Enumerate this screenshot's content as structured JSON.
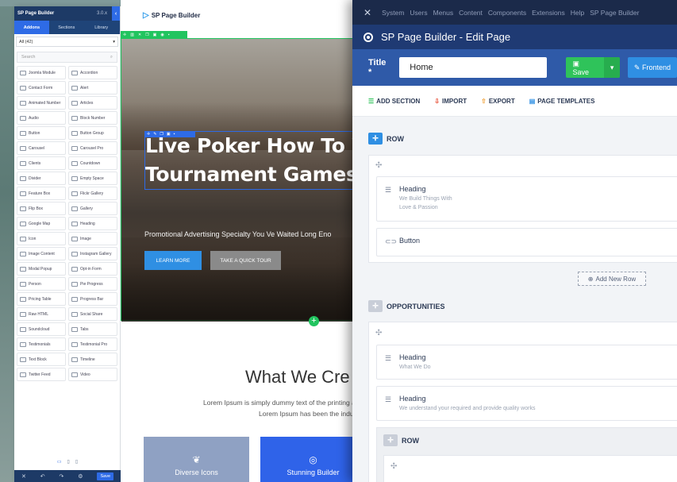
{
  "panel": {
    "title": "SP Page Builder",
    "version": "3.0.x",
    "collapse_icon": "‹",
    "tabs": [
      "Addons",
      "Sections",
      "Library"
    ],
    "filter": "All (42)",
    "search_placeholder": "Search",
    "addons": [
      "Joomla Module",
      "Accordion",
      "Contact Form",
      "Alert",
      "Animated Number",
      "Articles",
      "Audio",
      "Block Number",
      "Button",
      "Button Group",
      "Carousel",
      "Carousel Pro",
      "Clients",
      "Countdown",
      "Divider",
      "Empty Space",
      "Feature Box",
      "Flickr Gallery",
      "Flip Box",
      "Gallery",
      "Google Map",
      "Heading",
      "Icon",
      "Image",
      "Image Content",
      "Instagram Gallery",
      "Modal Popup",
      "Opt-in Form",
      "Person",
      "Pie Progress",
      "Pricing Table",
      "Progress Bar",
      "Raw HTML",
      "Social Share",
      "Soundcloud",
      "Tabs",
      "Testimonials",
      "Testimonial Pro",
      "Text Block",
      "Timeline",
      "Twitter Feed",
      "Video"
    ],
    "devices": [
      "▭",
      "▯",
      "▯"
    ],
    "footer": {
      "close": "✕",
      "undo": "↶",
      "redo": "↷",
      "settings": "⚙",
      "save": "Save"
    }
  },
  "canvas": {
    "logo": "SP Page Builder",
    "hero_line1": "Live Poker How To W",
    "hero_line2": "Tournament Games",
    "hero_sub": "Promotional Advertising Specialty You Ve Waited Long Eno",
    "learn_more": "LEARN MORE",
    "tour": "TAKE A QUICK TOUR",
    "add_symbol": "+",
    "section_title": "What We Cre",
    "section_text1": "Lorem Ipsum is simply dummy text of the printing a",
    "section_text2": "Lorem Ipsum has been the indu",
    "card1": "Diverse Icons",
    "card2": "Stunning Builder"
  },
  "admin": {
    "menu": [
      "System",
      "Users",
      "Menus",
      "Content",
      "Components",
      "Extensions",
      "Help",
      "SP Page Builder"
    ],
    "window_title": "SP Page Builder - Edit Page",
    "title_label": "Title *",
    "title_value": "Home",
    "save": "Save",
    "frontend": "Frontend",
    "actions": [
      "ADD SECTION",
      "IMPORT",
      "EXPORT",
      "PAGE TEMPLATES"
    ],
    "rows": {
      "row1_label": "ROW",
      "heading1_title": "Heading",
      "heading1_sub1": "We Build Things With",
      "heading1_sub2": "Love & Passion",
      "button_title": "Button",
      "add_new_row": "Add New Row",
      "row2_label": "OPPORTUNITIES",
      "heading2_title": "Heading",
      "heading2_sub": "What We Do",
      "heading3_title": "Heading",
      "heading3_sub": "We understand your required and provide quality works",
      "row3_label": "ROW"
    }
  },
  "colors": {
    "brand_blue": "#2e6be6",
    "green": "#21c45f",
    "navy": "#1b2a4a"
  }
}
